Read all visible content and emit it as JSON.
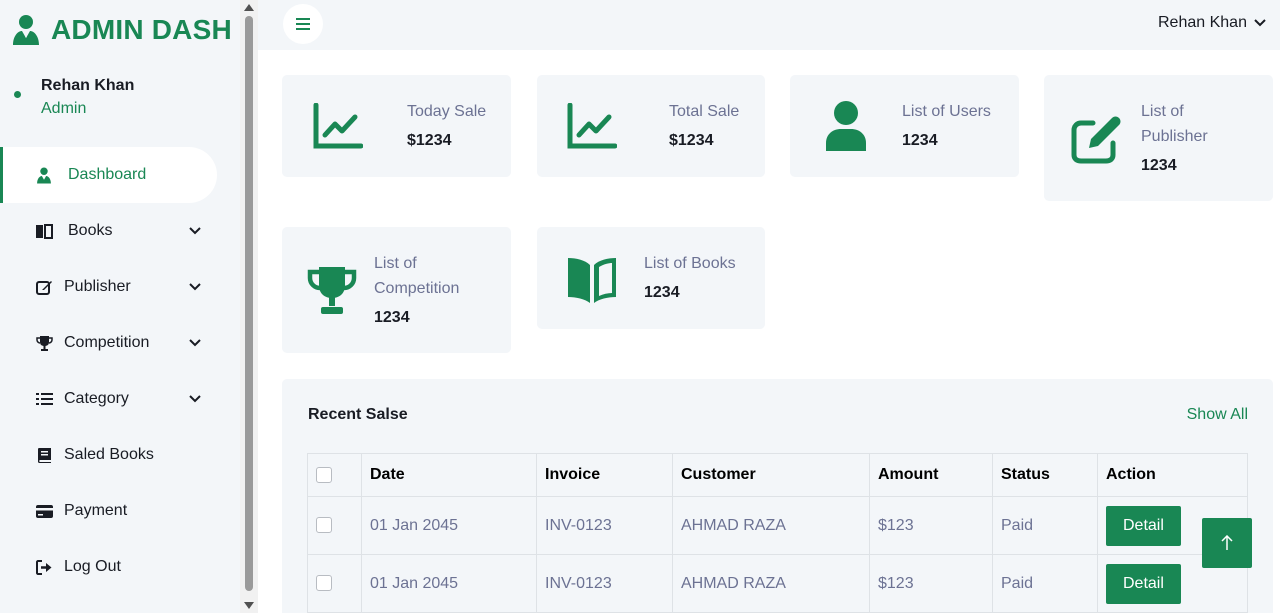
{
  "brand": {
    "title": "ADMIN DASH",
    "icon": "user-tie-icon",
    "color": "#198754"
  },
  "profile": {
    "name": "Rehan Khan",
    "role": "Admin"
  },
  "sidebar": {
    "items": [
      {
        "label": "Dashboard",
        "icon": "user-tie-icon",
        "active": true,
        "has_submenu": false
      },
      {
        "label": "Books",
        "icon": "book-icon",
        "has_submenu": true
      },
      {
        "label": "Publisher",
        "icon": "edit-icon",
        "has_submenu": true
      },
      {
        "label": "Competition",
        "icon": "trophy-icon",
        "has_submenu": true
      },
      {
        "label": "Category",
        "icon": "list-icon",
        "has_submenu": true
      },
      {
        "label": "Saled Books",
        "icon": "book-closed-icon",
        "has_submenu": false
      },
      {
        "label": "Payment",
        "icon": "credit-card-icon",
        "has_submenu": false
      },
      {
        "label": "Log Out",
        "icon": "sign-out-icon",
        "has_submenu": false
      }
    ]
  },
  "topbar": {
    "user_name": "Rehan Khan",
    "menu_icon": "hamburger-icon"
  },
  "stats": [
    {
      "label": "Today Sale",
      "value": "$1234",
      "icon": "line-chart-icon"
    },
    {
      "label": "Total Sale",
      "value": "$1234",
      "icon": "line-chart-icon"
    },
    {
      "label": "List of Users",
      "value": "1234",
      "icon": "user-icon"
    },
    {
      "label": "List of Publisher",
      "label_line1": "List of",
      "label_line2": "Publisher",
      "value": "1234",
      "icon": "edit-icon"
    },
    {
      "label": "List of Competition",
      "label_line1": "List of",
      "label_line2": "Competition",
      "value": "1234",
      "icon": "trophy-icon"
    },
    {
      "label": "List of Books",
      "value": "1234",
      "icon": "book-open-icon"
    }
  ],
  "recent_sales": {
    "title": "Recent Salse",
    "show_all": "Show All",
    "columns": [
      "Date",
      "Invoice",
      "Customer",
      "Amount",
      "Status",
      "Action"
    ],
    "rows": [
      {
        "date": "01 Jan 2045",
        "invoice": "INV-0123",
        "customer": "AHMAD RAZA",
        "amount": "$123",
        "status": "Paid",
        "action": "Detail"
      },
      {
        "date": "01 Jan 2045",
        "invoice": "INV-0123",
        "customer": "AHMAD RAZA",
        "amount": "$123",
        "status": "Paid",
        "action": "Detail"
      }
    ]
  },
  "colors": {
    "accent": "#198754",
    "background": "#f3f6f9",
    "muted_text": "#6c7293"
  }
}
